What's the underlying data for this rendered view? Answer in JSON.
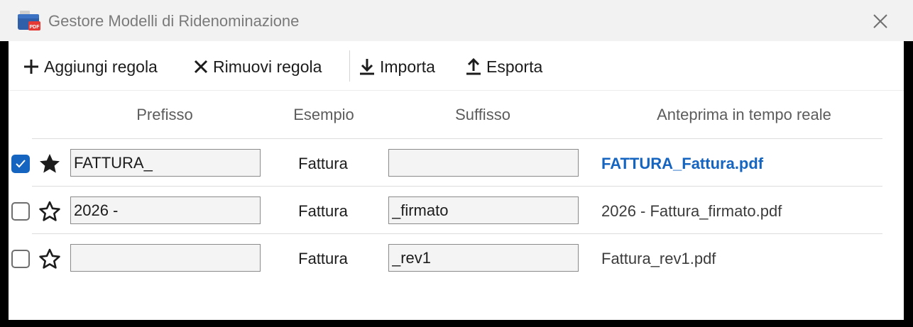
{
  "window": {
    "title": "Gestore Modelli di Ridenominazione",
    "app_icon": "pdf-app-icon",
    "close_icon": "close-icon"
  },
  "toolbar": {
    "add_label": "Aggiungi regola",
    "remove_label": "Rimuovi regola",
    "import_label": "Importa",
    "export_label": "Esporta"
  },
  "table": {
    "headers": {
      "prefix": "Prefisso",
      "example": "Esempio",
      "suffix": "Suffisso",
      "preview": "Anteprima in tempo reale"
    },
    "rows": [
      {
        "checked": true,
        "starred": true,
        "prefix": "FATTURA_",
        "example": "Fattura",
        "suffix": "",
        "preview": "FATTURA_Fattura.pdf",
        "preview_active": true
      },
      {
        "checked": false,
        "starred": false,
        "prefix": "2026 -",
        "example": "Fattura",
        "suffix": "_firmato",
        "preview": "2026 - Fattura_firmato.pdf",
        "preview_active": false
      },
      {
        "checked": false,
        "starred": false,
        "prefix": "",
        "example": "Fattura",
        "suffix": "_rev1",
        "preview": "Fattura_rev1.pdf",
        "preview_active": false
      }
    ]
  },
  "colors": {
    "accent": "#1565c0",
    "titlebar_bg": "#f2f2f2",
    "field_bg": "#f4f4f4"
  }
}
